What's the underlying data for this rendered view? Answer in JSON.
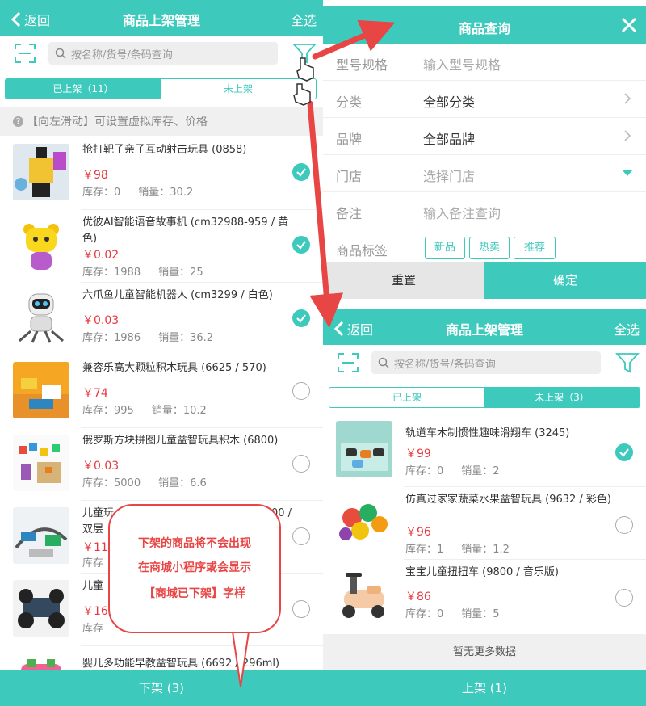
{
  "left": {
    "header": {
      "back_label": "返回",
      "title": "商品上架管理",
      "select_all": "全选"
    },
    "search": {
      "placeholder": "按名称/货号/条码查询"
    },
    "tabs": {
      "listed": "已上架（11）",
      "unlisted": "未上架"
    },
    "hint": "【向左滑动】可设置虚拟库存、价格",
    "items": [
      {
        "name": "抢打靶子亲子互动射击玩具 (0858)",
        "price": "￥98",
        "stock": "库存：0",
        "sales": "销量：30.2",
        "checked": true
      },
      {
        "name": "优彼AI智能语音故事机 (cm32988-959 / 黄色)",
        "price": "￥0.02",
        "stock": "库存：1988",
        "sales": "销量：25",
        "checked": true
      },
      {
        "name": "六爪鱼儿童智能机器人 (cm3299 / 白色)",
        "price": "￥0.03",
        "stock": "库存：1986",
        "sales": "销量：36.2",
        "checked": true
      },
      {
        "name": "兼容乐高大颗粒积木玩具 (6625 / 570)",
        "price": "￥74",
        "stock": "库存：995",
        "sales": "销量：10.2",
        "checked": false
      },
      {
        "name": "俄罗斯方块拼图儿童益智玩具积木 (6800)",
        "price": "￥0.03",
        "stock": "库存：5000",
        "sales": "销量：6.6",
        "checked": false
      },
      {
        "name": "儿童玩",
        "name2": "00 /",
        "name3": "双层",
        "price": "￥11",
        "stock": "库存",
        "sales": "",
        "checked": false
      },
      {
        "name": "儿童",
        "price": "￥16",
        "stock": "库存",
        "sales": "",
        "checked": false
      },
      {
        "name": "婴儿多功能早教益智玩具 (6692 / 296ml)",
        "price": "",
        "stock": "",
        "sales": "",
        "checked": false
      }
    ],
    "bottom_button": "下架 (3)"
  },
  "query": {
    "title": "商品查询",
    "rows": [
      {
        "label": "型号规格",
        "value": "输入型号规格",
        "placeholder": true
      },
      {
        "label": "分类",
        "value": "全部分类",
        "placeholder": false
      },
      {
        "label": "品牌",
        "value": "全部品牌",
        "placeholder": false
      },
      {
        "label": "门店",
        "value": "选择门店",
        "placeholder": true
      },
      {
        "label": "备注",
        "value": "输入备注查询",
        "placeholder": true
      }
    ],
    "tags_label": "商品标签",
    "tags": [
      "新品",
      "热卖",
      "推荐"
    ],
    "reset": "重置",
    "confirm": "确定"
  },
  "right": {
    "header": {
      "back_label": "返回",
      "title": "商品上架管理",
      "select_all": "全选"
    },
    "search": {
      "placeholder": "按名称/货号/条码查询"
    },
    "tabs": {
      "listed": "已上架",
      "unlisted": "未上架（3）"
    },
    "items": [
      {
        "name": "轨道车木制惯性趣味滑翔车 (3245)",
        "price": "￥99",
        "stock": "库存：0",
        "sales": "销量：2",
        "checked": true
      },
      {
        "name": "仿真过家家蔬菜水果益智玩具 (9632 / 彩色)",
        "price": "￥96",
        "stock": "库存：1",
        "sales": "销量：1.2",
        "checked": false
      },
      {
        "name": "宝宝儿童扭扭车 (9800 / 音乐版)",
        "price": "￥86",
        "stock": "库存：0",
        "sales": "销量：5",
        "checked": false
      }
    ],
    "no_more": "暂无更多数据",
    "bottom_button": "上架 (1)"
  },
  "callout": {
    "line1": "下架的商品将不会出现",
    "line2": "在商城小程序或会显示",
    "line3": "【商城已下架】字样"
  },
  "colors": {
    "accent": "#3ec9bd",
    "price": "#e8383d",
    "callout": "#e84545"
  }
}
